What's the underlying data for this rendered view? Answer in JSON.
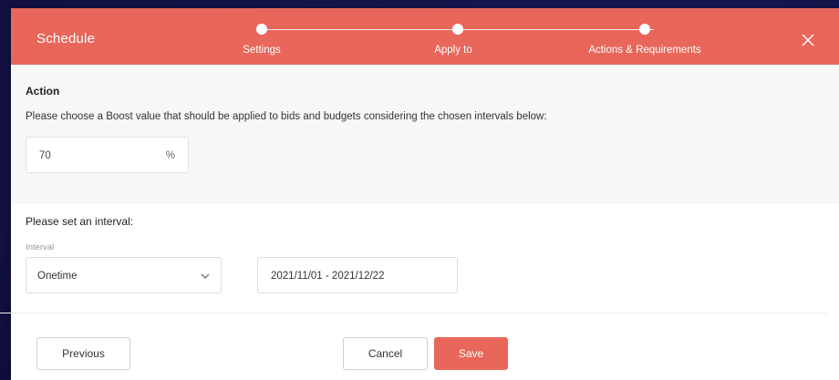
{
  "modal": {
    "title": "Schedule",
    "close_icon": "close-icon"
  },
  "stepper": {
    "steps": [
      {
        "label": "Settings"
      },
      {
        "label": "Apply to"
      },
      {
        "label": "Actions & Requirements"
      }
    ]
  },
  "action": {
    "heading": "Action",
    "description": "Please choose a Boost value that should be applied to bids and budgets considering the chosen intervals below:",
    "boost_value": "70",
    "boost_unit": "%"
  },
  "interval": {
    "heading": "Please set an interval:",
    "field_label": "Interval",
    "selected": "Onetime",
    "date_range": "2021/11/01 - 2021/12/22"
  },
  "footer": {
    "previous_label": "Previous",
    "cancel_label": "Cancel",
    "save_label": "Save"
  },
  "colors": {
    "accent": "#e8675a",
    "backdrop": "#131245"
  }
}
